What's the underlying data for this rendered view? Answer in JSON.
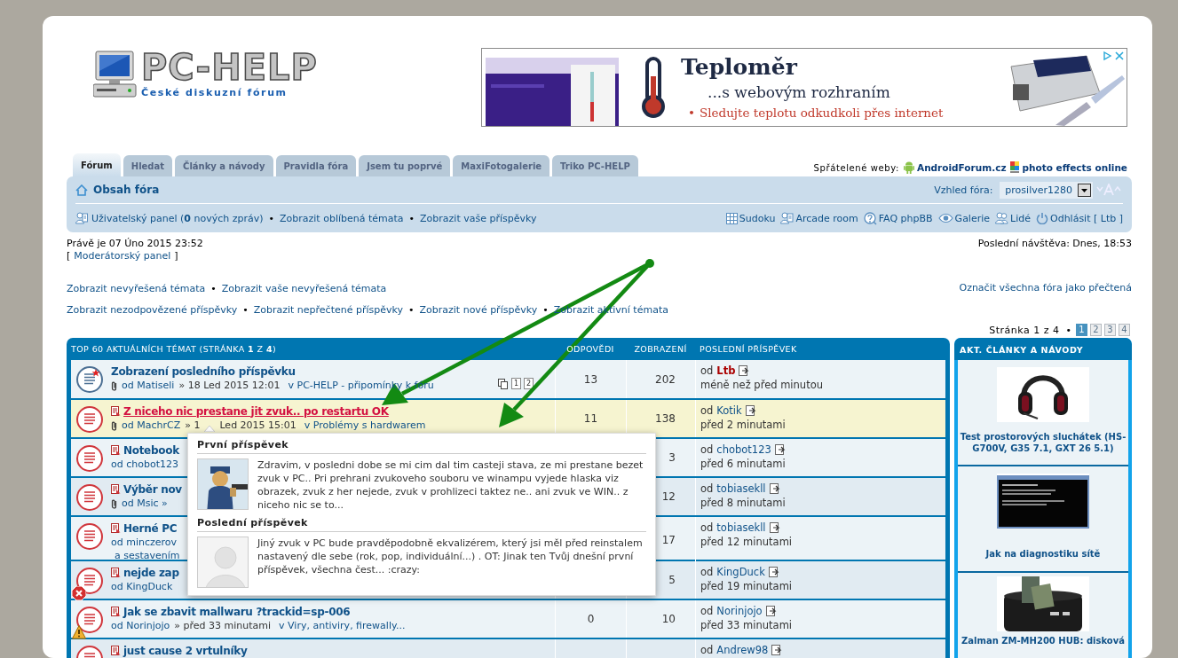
{
  "logo": {
    "title": "PC-HELP",
    "subtitle": "České diskuzní fórum"
  },
  "ad": {
    "title": "Teploměr",
    "subtitle": "...s webovým rozhraním",
    "bullet": "•",
    "line": "Sledujte teplotu odkudkoli přes internet"
  },
  "tabs": [
    {
      "label": "Fórum",
      "selected": true
    },
    {
      "label": "Hledat",
      "selected": false
    },
    {
      "label": "Články a návody",
      "selected": false
    },
    {
      "label": "Pravidla fóra",
      "selected": false
    },
    {
      "label": "Jsem tu poprvé",
      "selected": false
    },
    {
      "label": "MaxiFotogalerie",
      "selected": false
    },
    {
      "label": "Triko PC-HELP",
      "selected": false
    }
  ],
  "friends": {
    "label": "Spřátelené weby:",
    "links": [
      {
        "label": "AndroidForum.cz",
        "kind": "android"
      },
      {
        "label": "photo effects online",
        "kind": "fotor"
      }
    ]
  },
  "navbar": {
    "home": "Obsah fóra",
    "style_label": "Vzhled fóra:",
    "style_value": "prosilver1280",
    "separator": "•",
    "user_links": [
      {
        "text": "Uživatelský panel (**0** nových zpráv)",
        "kind": "ucp"
      },
      {
        "text": "Zobrazit oblíbená témata",
        "kind": "plain"
      },
      {
        "text": "Zobrazit vaše příspěvky",
        "kind": "plain"
      }
    ],
    "tools": [
      {
        "label": "Sudoku",
        "kind": "grid"
      },
      {
        "label": "Arcade room",
        "kind": "user"
      },
      {
        "label": "FAQ phpBB",
        "kind": "faq"
      },
      {
        "label": "Galerie",
        "kind": "eye"
      },
      {
        "label": "Lidé",
        "kind": "people"
      },
      {
        "label": "Odhlásit [ Ltb ]",
        "kind": "power"
      }
    ]
  },
  "info": {
    "time": "Právě je 07 Úno 2015 23:52",
    "mcp_open": "[",
    "mcp": "Moderátorský panel",
    "mcp_close": "]",
    "last_visit": "Poslední návštěva: Dnes, 18:53"
  },
  "search_links": {
    "separator": "•",
    "lines": [
      [
        "Zobrazit nevyřešená témata",
        "Zobrazit vaše nevyřešená témata"
      ],
      [
        "Zobrazit nezodpovězené příspěvky",
        "Zobrazit nepřečtené příspěvky",
        "Zobrazit nové příspěvky",
        "Zobrazit aktivní témata"
      ]
    ],
    "mark_read": "Označit všechna fóra jako přečtená"
  },
  "pagination": {
    "label": "Stránka 1 z 4",
    "separator": "•",
    "pages": [
      {
        "label": "1",
        "selected": true
      },
      {
        "label": "2",
        "selected": false
      },
      {
        "label": "3",
        "selected": false
      },
      {
        "label": "4",
        "selected": false
      }
    ]
  },
  "topics": {
    "title": "TOP 60 AKTUÁLNÍCH TÉMAT (STRÁNKA **1** Z **4**)",
    "columns": [
      "ODPOVĚDI",
      "ZOBRAZENÍ",
      "POSLEDNÍ PŘÍSPĚVEK"
    ],
    "rows": [
      {
        "title": "Zobrazení posledního příspěvku",
        "unread": false,
        "own_post": true,
        "highlighted": false,
        "attachment": true,
        "author": "od Matiseli",
        "date": "» 18 Led 2015 12:01",
        "forum": "v PC-HELP - připomínky k fóru",
        "pages": [
          "1",
          "2"
        ],
        "replies": "13",
        "views": "202",
        "last": {
          "prefix": "od",
          "author": "Ltb",
          "color": "#aa0000",
          "time": "méně než před minutou"
        }
      },
      {
        "title": "Z niceho nic prestane jit zvuk.. po restartu OK",
        "unread": true,
        "own_post": false,
        "highlighted": true,
        "attachment": true,
        "author": "od MachrCZ",
        "date": "» 1",
        "date2": "Led 2015 15:01",
        "forum": "v Problémy s hardwarem",
        "replies": "11",
        "views": "138",
        "last": {
          "prefix": "od",
          "author": "Kotik",
          "color": "#105289",
          "time": "před 2 minutami"
        }
      },
      {
        "title": "Notebook",
        "unread": true,
        "own_post": false,
        "highlighted": false,
        "attachment": false,
        "author": "od chobot123",
        "views": "3",
        "last": {
          "prefix": "od",
          "author": "chobot123",
          "color": "#105289",
          "time": "před 6 minutami"
        }
      },
      {
        "title": "Výběr nov",
        "unread": true,
        "own_post": false,
        "highlighted": false,
        "attachment": true,
        "author": "od Msic »",
        "views": "12",
        "last": {
          "prefix": "od",
          "author": "tobiasekll",
          "color": "#105289",
          "time": "před 8 minutami"
        }
      },
      {
        "title": "Herné PC",
        "unread": true,
        "own_post": false,
        "highlighted": false,
        "attachment": false,
        "author": "od minczerov",
        "extra": "a sestavením",
        "views": "17",
        "last": {
          "prefix": "od",
          "author": "tobiasekll",
          "color": "#105289",
          "time": "před 12 minutami"
        }
      },
      {
        "title": "nejde zap",
        "unread": true,
        "own_post": false,
        "highlighted": false,
        "attachment": false,
        "badge": {
          "kind": "error"
        },
        "author": "od KingDuck",
        "views": "5",
        "last": {
          "prefix": "od",
          "author": "KingDuck",
          "color": "#105289",
          "time": "před 19 minutami"
        }
      },
      {
        "title": "Jak se zbavit mallwaru ?trackid=sp-006",
        "unread": true,
        "own_post": false,
        "highlighted": false,
        "attachment": false,
        "badge": {
          "kind": "warning"
        },
        "author": "od Norinjojo",
        "date": "» před 33 minutami",
        "forum": "v Viry, antiviry, firewally...",
        "replies": "0",
        "views": "10",
        "last": {
          "prefix": "od",
          "author": "Norinjojo",
          "color": "#105289",
          "time": "před 33 minutami"
        }
      },
      {
        "title": "just cause 2 vrtulníky",
        "unread": true,
        "own_post": false,
        "highlighted": false,
        "attachment": false,
        "last": {
          "prefix": "od",
          "author": "Andrew98",
          "color": "#105289"
        }
      }
    ]
  },
  "popup": {
    "sections": [
      {
        "heading": "První příspěvek",
        "avatar": {
          "kind": "custom"
        },
        "text": "Zdravim, v posledni dobe se mi cim dal tim casteji stava, ze mi prestane bezet zvuk v PC.. Pri prehrani zvukoveho souboru ve winampu vyjede hlaska viz obrazek, zvuk z her nejede, zvuk v prohlizeci taktez ne.. ani zvuk ve WIN.. z niceho nic se to..."
      },
      {
        "heading": "Poslední příspěvek",
        "avatar": {
          "kind": "default"
        },
        "text": "Jiný zvuk v PC bude pravděpodobně ekvalizérem, který jsi měl před reinstalem nastavený dle sebe (rok, pop, individuální...) . OT: Jinak ten Tvůj dnešní první příspěvek, všechna čest... :crazy:"
      }
    ]
  },
  "sidebar": {
    "title": "AKT. ČLÁNKY A NÁVODY",
    "items": [
      {
        "title": "Test prostorových sluchátek (HS-G700V, G35 7.1, GXT 26 5.1)",
        "kind": "picture"
      },
      {
        "title": "Jak na diagnostiku sítě",
        "kind": "picture"
      },
      {
        "title": "Zalman ZM-MH200 HUB: disková",
        "kind": "picture"
      }
    ]
  }
}
